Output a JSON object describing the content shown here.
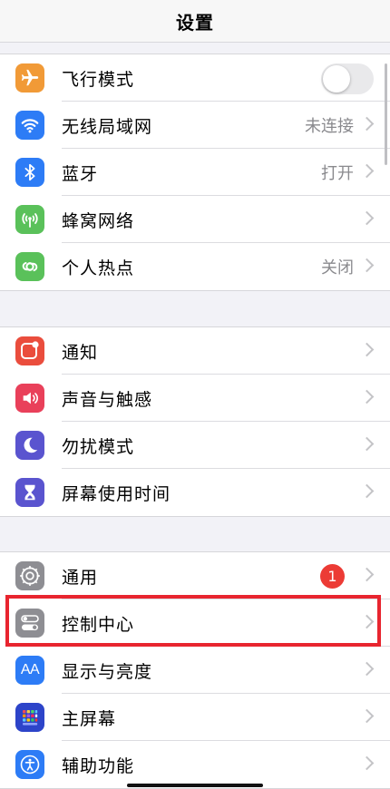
{
  "title": "设置",
  "groups": [
    {
      "items": [
        {
          "label": "飞行模式",
          "icon": "airplane-icon",
          "color": "#f19a37",
          "control": "toggle",
          "on": false
        },
        {
          "label": "无线局域网",
          "value": "未连接",
          "icon": "wifi-icon",
          "color": "#2d7cf6"
        },
        {
          "label": "蓝牙",
          "value": "打开",
          "icon": "bluetooth-icon",
          "color": "#2d7cf6"
        },
        {
          "label": "蜂窝网络",
          "value": "",
          "icon": "cellular-icon",
          "color": "#5ac15a"
        },
        {
          "label": "个人热点",
          "value": "关闭",
          "icon": "hotspot-icon",
          "color": "#5ac15a"
        }
      ]
    },
    {
      "items": [
        {
          "label": "通知",
          "icon": "notifications-icon",
          "color": "#ea4d3d"
        },
        {
          "label": "声音与触感",
          "icon": "sound-icon",
          "color": "#e9405a"
        },
        {
          "label": "勿扰模式",
          "icon": "moon-icon",
          "color": "#5a54cf"
        },
        {
          "label": "屏幕使用时间",
          "icon": "hourglass-icon",
          "color": "#5a54cf"
        }
      ]
    },
    {
      "items": [
        {
          "label": "通用",
          "badge": "1",
          "icon": "gear-icon",
          "color": "#8e8e93"
        },
        {
          "label": "控制中心",
          "icon": "control-center-icon",
          "color": "#8e8e93",
          "highlighted": true
        },
        {
          "label": "显示与亮度",
          "icon": "display-icon",
          "color": "#2d7cf6"
        },
        {
          "label": "主屏幕",
          "icon": "home-screen-icon",
          "color": "#2d44c9"
        },
        {
          "label": "辅助功能",
          "icon": "accessibility-icon",
          "color": "#2d7cf6"
        }
      ]
    }
  ]
}
